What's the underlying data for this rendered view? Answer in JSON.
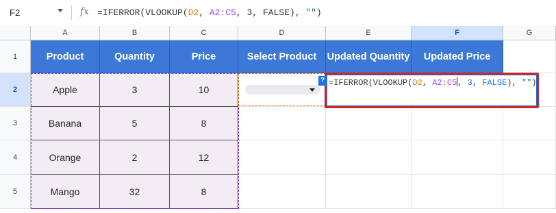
{
  "formula_bar": {
    "cell_ref": "F2",
    "fx_label": "fx",
    "formula_parts": [
      {
        "text": "=IFERROR(VLOOKUP(",
        "cls": ""
      },
      {
        "text": "D2",
        "cls": "c-orange"
      },
      {
        "text": ", ",
        "cls": ""
      },
      {
        "text": "A2:C5",
        "cls": "c-purple"
      },
      {
        "text": ", ",
        "cls": ""
      },
      {
        "text": "3",
        "cls": ""
      },
      {
        "text": ", FALSE), ",
        "cls": ""
      },
      {
        "text": "\"\"",
        "cls": "c-green"
      },
      {
        "text": ")",
        "cls": ""
      }
    ]
  },
  "columns": [
    "A",
    "B",
    "C",
    "D",
    "E",
    "F",
    "G"
  ],
  "rows": [
    "1",
    "2",
    "3",
    "4",
    "5"
  ],
  "header_row": [
    "Product",
    "Quantity",
    "Price",
    "Select Product",
    "Updated Quantity",
    "Updated Price"
  ],
  "data": [
    [
      "Apple",
      "3",
      "10"
    ],
    [
      "Banana",
      "5",
      "8"
    ],
    [
      "Orange",
      "2",
      "12"
    ],
    [
      "Mango",
      "32",
      "8"
    ]
  ],
  "editor": {
    "help_label": "?",
    "parts": [
      {
        "text": "=IFERROR(VLOOKUP(",
        "cls": ""
      },
      {
        "text": "D2",
        "cls": "c-orange"
      },
      {
        "text": ", ",
        "cls": ""
      },
      {
        "text": "A2:C5",
        "cls": "c-purple"
      },
      {
        "text": "|",
        "cls": "caret"
      },
      {
        "text": ", ",
        "cls": ""
      },
      {
        "text": "3",
        "cls": "c-blue"
      },
      {
        "text": ", ",
        "cls": ""
      },
      {
        "text": "FALSE",
        "cls": "c-blue"
      },
      {
        "text": "), ",
        "cls": ""
      },
      {
        "text": "\"\"",
        "cls": "c-green"
      },
      {
        "text": ")",
        "cls": ""
      }
    ]
  },
  "colors": {
    "header_fill": "#3c78d8",
    "data_fill": "#f4ecf4",
    "selection": "#d3e3fd",
    "highlight_box": "#c62828"
  }
}
